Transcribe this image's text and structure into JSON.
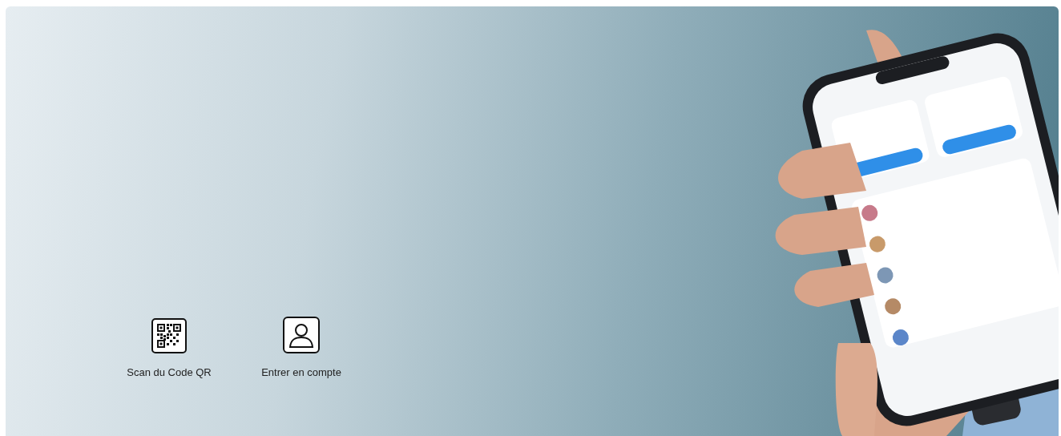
{
  "features": [
    {
      "kind": "qr",
      "label": "Scan du Code QR"
    },
    {
      "kind": "account",
      "label": "Entrer en compte"
    }
  ]
}
